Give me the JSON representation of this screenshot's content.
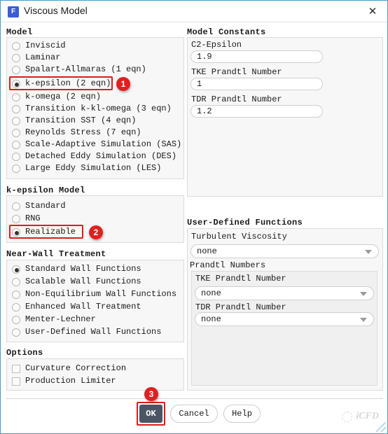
{
  "window": {
    "title": "Viscous Model",
    "icon": "fluent-app-icon",
    "icon_letter": "F",
    "close_label": "✕"
  },
  "model_group": {
    "title": "Model",
    "items": [
      {
        "label": "Inviscid",
        "selected": false
      },
      {
        "label": "Laminar",
        "selected": false
      },
      {
        "label": "Spalart-Allmaras (1 eqn)",
        "selected": false
      },
      {
        "label": "k-epsilon (2 eqn)",
        "selected": true
      },
      {
        "label": "k-omega (2 eqn)",
        "selected": false
      },
      {
        "label": "Transition k-kl-omega (3 eqn)",
        "selected": false
      },
      {
        "label": "Transition SST (4 eqn)",
        "selected": false
      },
      {
        "label": "Reynolds Stress (7 eqn)",
        "selected": false
      },
      {
        "label": "Scale-Adaptive Simulation (SAS)",
        "selected": false
      },
      {
        "label": "Detached Eddy Simulation (DES)",
        "selected": false
      },
      {
        "label": "Large Eddy Simulation (LES)",
        "selected": false
      }
    ]
  },
  "kepsilon_group": {
    "title": "k-epsilon Model",
    "items": [
      {
        "label": "Standard",
        "selected": false
      },
      {
        "label": "RNG",
        "selected": false
      },
      {
        "label": "Realizable",
        "selected": true
      }
    ]
  },
  "nearwall_group": {
    "title": "Near-Wall Treatment",
    "items": [
      {
        "label": "Standard Wall Functions",
        "selected": true
      },
      {
        "label": "Scalable Wall Functions",
        "selected": false
      },
      {
        "label": "Non-Equilibrium Wall Functions",
        "selected": false
      },
      {
        "label": "Enhanced Wall Treatment",
        "selected": false
      },
      {
        "label": "Menter-Lechner",
        "selected": false
      },
      {
        "label": "User-Defined Wall Functions",
        "selected": false
      }
    ]
  },
  "options_group": {
    "title": "Options",
    "items": [
      {
        "label": "Curvature Correction",
        "checked": false
      },
      {
        "label": "Production Limiter",
        "checked": false
      }
    ]
  },
  "model_constants": {
    "title": "Model Constants",
    "fields": [
      {
        "label": "C2-Epsilon",
        "value": "1.9"
      },
      {
        "label": "TKE Prandtl Number",
        "value": "1"
      },
      {
        "label": "TDR Prandtl Number",
        "value": "1.2"
      }
    ]
  },
  "udf": {
    "title": "User-Defined Functions",
    "turbulent_viscosity_label": "Turbulent Viscosity",
    "turbulent_viscosity_value": "none",
    "prandtl_group_title": "Prandtl Numbers",
    "prandtl_fields": [
      {
        "label": "TKE Prandtl Number",
        "value": "none"
      },
      {
        "label": "TDR Prandtl Number",
        "value": "none"
      }
    ]
  },
  "footer": {
    "ok_label": "OK",
    "cancel_label": "Cancel",
    "help_label": "Help"
  },
  "annotations": {
    "badges": [
      "1",
      "2",
      "3"
    ]
  },
  "watermark": {
    "text": "iCFD"
  },
  "colors": {
    "accent_red": "#e02020",
    "ok_button": "#4b5563",
    "window_border": "#4a9bc4",
    "panel_bg": "#f7f7f7"
  }
}
